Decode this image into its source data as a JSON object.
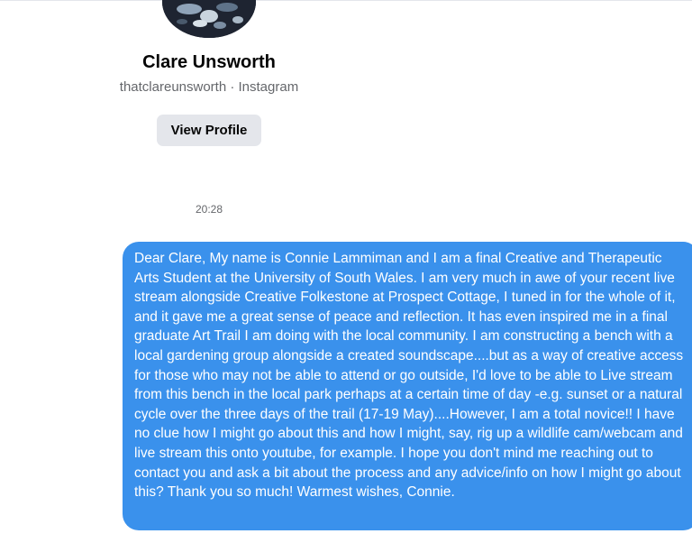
{
  "profile": {
    "name": "Clare Unsworth",
    "subtitle": "thatclareunsworth · Instagram",
    "view_profile_label": "View Profile"
  },
  "conversation": {
    "timestamp": "20:28",
    "message": "Dear Clare, My name is Connie Lammiman and I am a final Creative and Therapeutic Arts Student at the University of South Wales. I am very much in awe of your recent live stream alongside Creative Folkestone at Prospect Cottage, I tuned in for the whole of it, and it gave me a great sense of peace and reflection. It has even inspired me in a final graduate Art Trail I am doing with the local community. I am constructing a bench with a local gardening group alongside a created soundscape....but as a way of creative access for those who may not be able to attend or go outside, I'd love to be able to Live stream from this bench in the local park perhaps at a certain time of day -e.g. sunset or a natural cycle over the three days of the trail (17-19 May)....However, I am a total novice!! I have no clue how I might go about this and how I might, say, rig up a wildlife cam/webcam and live stream this onto youtube, for example. I hope you don't mind me reaching out to contact you and ask a bit about the process and any advice/info on how I might go about this? Thank you so much! Warmest wishes, Connie."
  },
  "colors": {
    "bubble_background": "#3a91ec",
    "button_background": "#e4e6eb",
    "secondary_text": "#65676b"
  }
}
